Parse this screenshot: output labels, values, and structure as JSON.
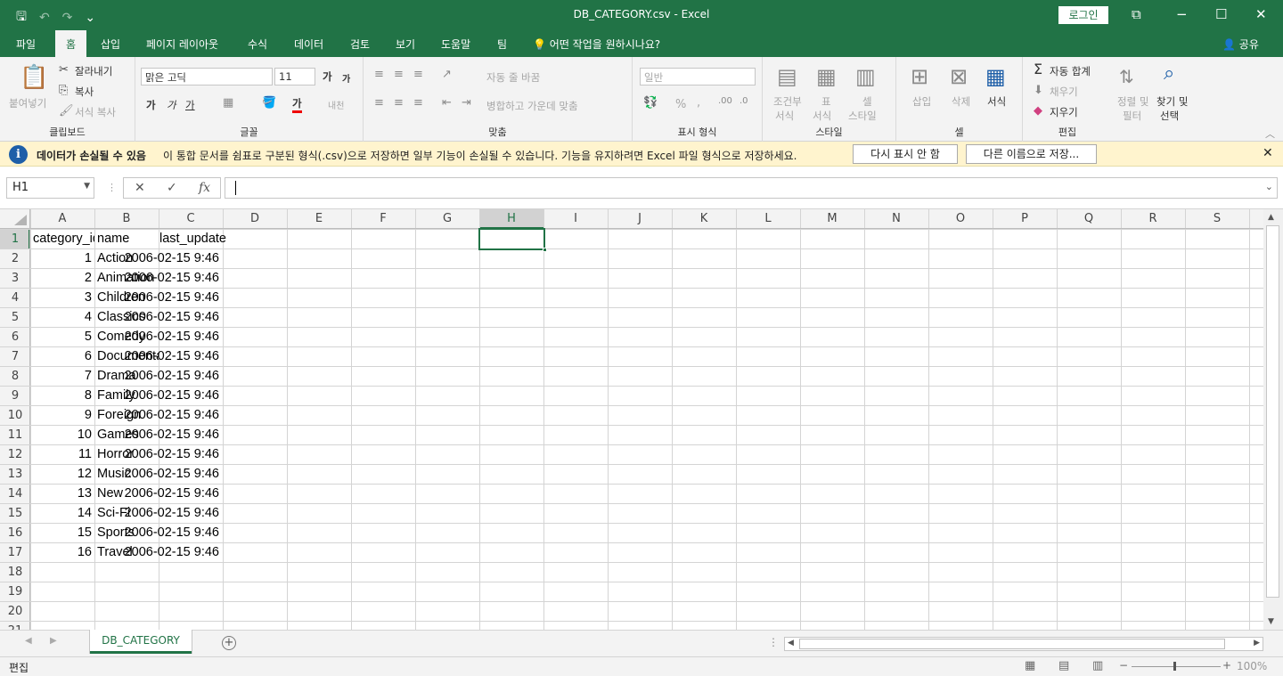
{
  "window": {
    "title": "DB_CATEGORY.csv  -  Excel",
    "login_label": "로그인",
    "minimize": "−",
    "restore": "☐",
    "close": "✕",
    "ribbon_display": "⧉"
  },
  "qat": {
    "save": "🖫",
    "undo": "↶",
    "redo": "↷",
    "customize": "⌄"
  },
  "tabs": [
    "파일",
    "홈",
    "삽입",
    "페이지 레이아웃",
    "수식",
    "데이터",
    "검토",
    "보기",
    "도움말",
    "팀"
  ],
  "active_tab": "홈",
  "tell_me": "어떤 작업을 원하시나요?",
  "share": "공유",
  "ribbon": {
    "clipboard": {
      "paste": "붙여넣기",
      "cut": "잘라내기",
      "copy": "복사",
      "format_painter": "서식 복사",
      "label": "클립보드"
    },
    "font": {
      "name": "맑은 고딕",
      "size": "11",
      "grow": "가",
      "shrink": "가",
      "bold": "가",
      "italic": "가",
      "underline": "가",
      "color": "가",
      "phonetic": "내천",
      "label": "글꼴"
    },
    "alignment": {
      "wrap": "자동 줄 바꿈",
      "merge": "병합하고 가운데 맞춤",
      "label": "맞춤"
    },
    "number": {
      "format": "일반",
      "percent": "%",
      "comma": ",",
      "label": "표시 형식"
    },
    "styles": {
      "conditional": "조건부",
      "conditional2": "서식",
      "table": "표",
      "table2": "서식",
      "cell": "셀",
      "cell2": "스타일",
      "label": "스타일"
    },
    "cells": {
      "insert": "삽입",
      "delete": "삭제",
      "format": "서식",
      "label": "셀"
    },
    "editing": {
      "autosum": "자동 합계",
      "fill": "채우기",
      "clear": "지우기",
      "sort": "정렬 및",
      "sort2": "필터",
      "find": "찾기 및",
      "find2": "선택",
      "label": "편집"
    }
  },
  "infobar": {
    "title": "데이터가 손실될 수 있음",
    "message": "이 통합 문서를 쉼표로 구분된 형식(.csv)으로 저장하면 일부 기능이 손실될 수 있습니다. 기능을 유지하려면 Excel 파일 형식으로 저장하세요.",
    "dont_show": "다시 표시 안 함",
    "save_as": "다른 이름으로 저장...",
    "close": "✕"
  },
  "formula_bar": {
    "name_box": "H1",
    "cancel": "✕",
    "enter": "✓",
    "fx": "fx",
    "value": ""
  },
  "columns": [
    "A",
    "B",
    "C",
    "D",
    "E",
    "F",
    "G",
    "H",
    "I",
    "J",
    "K",
    "L",
    "M",
    "N",
    "O",
    "P",
    "Q",
    "R",
    "S"
  ],
  "row_numbers": [
    "1",
    "2",
    "3",
    "4",
    "5",
    "6",
    "7",
    "8",
    "9",
    "10",
    "11",
    "12",
    "13",
    "14",
    "15",
    "16",
    "17",
    "18",
    "19",
    "20",
    "21"
  ],
  "selected_cell": "H1",
  "sheet": {
    "headers": [
      "category_id",
      "name",
      "last_update"
    ],
    "rows": [
      [
        "1",
        "Action",
        "2006-02-15 9:46"
      ],
      [
        "2",
        "Animation",
        "2006-02-15 9:46"
      ],
      [
        "3",
        "Children",
        "2006-02-15 9:46"
      ],
      [
        "4",
        "Classics",
        "2006-02-15 9:46"
      ],
      [
        "5",
        "Comedy",
        "2006-02-15 9:46"
      ],
      [
        "6",
        "Documentary",
        "2006-02-15 9:46"
      ],
      [
        "7",
        "Drama",
        "2006-02-15 9:46"
      ],
      [
        "8",
        "Family",
        "2006-02-15 9:46"
      ],
      [
        "9",
        "Foreign",
        "2006-02-15 9:46"
      ],
      [
        "10",
        "Games",
        "2006-02-15 9:46"
      ],
      [
        "11",
        "Horror",
        "2006-02-15 9:46"
      ],
      [
        "12",
        "Music",
        "2006-02-15 9:46"
      ],
      [
        "13",
        "New",
        "2006-02-15 9:46"
      ],
      [
        "14",
        "Sci-Fi",
        "2006-02-15 9:46"
      ],
      [
        "15",
        "Sports",
        "2006-02-15 9:46"
      ],
      [
        "16",
        "Travel",
        "2006-02-15 9:46"
      ]
    ]
  },
  "sheet_tab": "DB_CATEGORY",
  "add_sheet": "+",
  "status": {
    "mode": "편집",
    "zoom": "100%"
  },
  "colors": {
    "accent": "#217346",
    "ribbon_bg": "#f3f3f3",
    "infobar_bg": "#fff4ce",
    "grid_line": "#d4d4d4"
  }
}
